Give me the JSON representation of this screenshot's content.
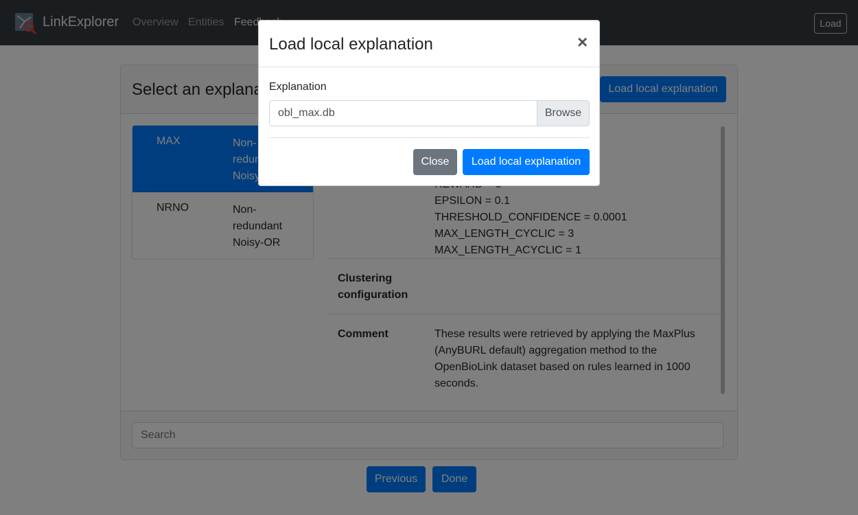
{
  "navbar": {
    "brand": "LinkExplorer",
    "links": [
      "Overview",
      "Entities",
      "Feedback"
    ],
    "load_label": "Load"
  },
  "card": {
    "title": "Select an explanation",
    "load_button": "Load local explanation",
    "explanations": [
      {
        "code": "MAX",
        "description": "Non-redundant Noisy-OR",
        "active": true
      },
      {
        "code": "NRNO",
        "description": "Non-redundant Noisy-OR",
        "active": false
      }
    ],
    "details": {
      "config_lines": [
        "REWARD = 5",
        "EPSILON = 0.1",
        "THRESHOLD_CONFIDENCE = 0.0001",
        "MAX_LENGTH_CYCLIC = 3",
        "MAX_LENGTH_ACYCLIC = 1"
      ],
      "clustering_label": "Clustering configuration",
      "comment_label": "Comment",
      "comment": "These results were retrieved by applying the MaxPlus (AnyBURL default) aggregation method to the OpenBioLink dataset based on rules learned in 1000 seconds."
    },
    "search_placeholder": "Search"
  },
  "buttons": {
    "previous": "Previous",
    "done": "Done"
  },
  "modal": {
    "title": "Load local explanation",
    "close_x": "×",
    "field_label": "Explanation",
    "file_name": "obl_max.db",
    "browse": "Browse",
    "close": "Close",
    "submit": "Load local explanation"
  },
  "colors": {
    "primary": "#007bff",
    "secondary": "#6c757d",
    "navbar": "#343a40"
  }
}
